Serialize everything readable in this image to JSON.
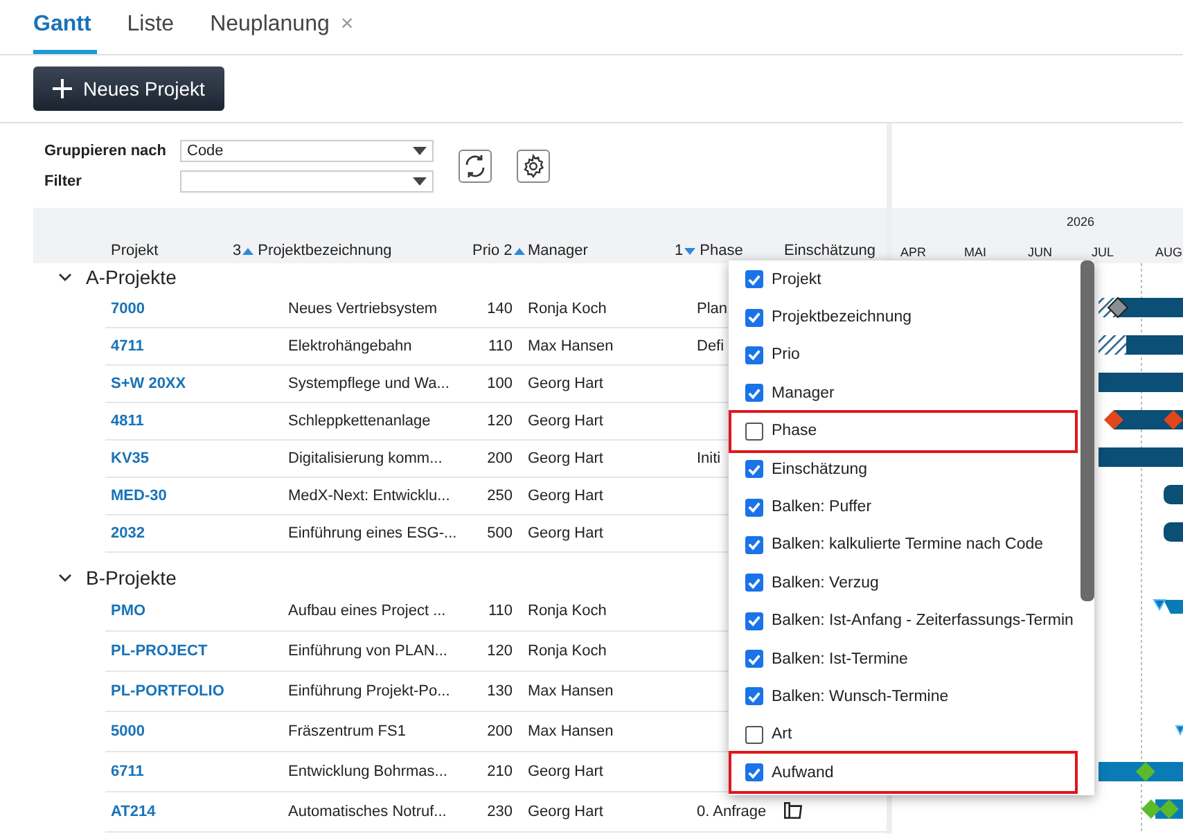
{
  "tabs": [
    {
      "label": "Gantt",
      "selected": true
    },
    {
      "label": "Liste",
      "selected": false
    },
    {
      "label": "Neuplanung",
      "selected": false,
      "close": "×"
    }
  ],
  "new_button": {
    "label": "Neues Projekt"
  },
  "filters": [
    {
      "label": "Gruppieren nach",
      "value": "Code"
    },
    {
      "label": "Filter"
    }
  ],
  "columns": [
    {
      "label": "Projekt",
      "kind": "text"
    },
    {
      "label": "Projektbezeichnung",
      "sort": "3",
      "descending": false,
      "kind": "text"
    },
    {
      "label": "Prio",
      "sort": "2",
      "descending": false,
      "kind": "number"
    },
    {
      "label": "Manager",
      "kind": "text"
    },
    {
      "label": "Phase",
      "sort": "1",
      "descending": true,
      "kind": "text"
    },
    {
      "label": "Einschätzung",
      "kind": "text"
    }
  ],
  "timeline": {
    "year": "2026",
    "months": [
      "APR",
      "MAI",
      "JUN",
      "JUL",
      "AUG"
    ]
  },
  "groups": [
    {
      "label": "A-Projekte",
      "expanded": true,
      "rows": [
        {
          "code": "7000",
          "name": "Neues Vertriebsystem",
          "prio": "140",
          "manager": "Ronja Koch",
          "phase": "Plan",
          "estimate": false
        },
        {
          "code": "4711",
          "name": "Elektrohängebahn",
          "prio": "110",
          "manager": "Max Hansen",
          "phase": "Defi",
          "estimate": false
        },
        {
          "code": "S+W 20XX",
          "name": "Systempflege und Wa...",
          "prio": "100",
          "manager": "Georg Hart",
          "estimate": false
        },
        {
          "code": "4811",
          "name": "Schleppkettenanlage",
          "prio": "120",
          "manager": "Georg Hart",
          "estimate": false
        },
        {
          "code": "KV35",
          "name": "Digitalisierung komm...",
          "prio": "200",
          "manager": "Georg Hart",
          "phase": "Initi",
          "estimate": false
        },
        {
          "code": "MED-30",
          "name": "MedX-Next: Entwicklu...",
          "prio": "250",
          "manager": "Georg Hart",
          "estimate": false
        },
        {
          "code": "2032",
          "name": "Einführung eines ESG-...",
          "prio": "500",
          "manager": "Georg Hart",
          "estimate": false
        }
      ]
    },
    {
      "label": "B-Projekte",
      "expanded": true,
      "rows": [
        {
          "code": "PMO",
          "name": "Aufbau eines Project ...",
          "prio": "110",
          "manager": "Ronja Koch",
          "estimate": false
        },
        {
          "code": "PL-PROJECT",
          "name": "Einführung von PLAN...",
          "prio": "120",
          "manager": "Ronja Koch",
          "estimate": false
        },
        {
          "code": "PL-PORTFOLIO",
          "name": "Einführung Projekt-Po...",
          "prio": "130",
          "manager": "Max Hansen",
          "estimate": false
        },
        {
          "code": "5000",
          "name": "Fräszentrum FS1",
          "prio": "200",
          "manager": "Max Hansen",
          "estimate": false
        },
        {
          "code": "6711",
          "name": "Entwicklung Bohrmas...",
          "prio": "210",
          "manager": "Georg Hart",
          "estimate": false
        },
        {
          "code": "AT214",
          "name": "Automatisches Notruf...",
          "prio": "230",
          "manager": "Georg Hart",
          "phase": "0. Anfrage",
          "estimate": true
        }
      ]
    }
  ],
  "column_menu": [
    {
      "label": "Projekt",
      "checked": true,
      "highlighted": false
    },
    {
      "label": "Projektbezeichnung",
      "checked": true,
      "highlighted": false
    },
    {
      "label": "Prio",
      "checked": true,
      "highlighted": false
    },
    {
      "label": "Manager",
      "checked": true,
      "highlighted": false
    },
    {
      "label": "Phase",
      "checked": false,
      "highlighted": true
    },
    {
      "label": "Einschätzung",
      "checked": true,
      "highlighted": false
    },
    {
      "label": "Balken: Puffer",
      "checked": true,
      "highlighted": false
    },
    {
      "label": "Balken: kalkulierte Termine nach Code",
      "checked": true,
      "highlighted": false
    },
    {
      "label": "Balken: Verzug",
      "checked": true,
      "highlighted": false
    },
    {
      "label": "Balken: Ist-Anfang - Zeiterfassungs-Termin",
      "checked": true,
      "highlighted": false
    },
    {
      "label": "Balken: Ist-Termine",
      "checked": true,
      "highlighted": false
    },
    {
      "label": "Balken: Wunsch-Termine",
      "checked": true,
      "highlighted": false
    },
    {
      "label": "Art",
      "checked": false,
      "highlighted": false
    },
    {
      "label": "Aufwand",
      "checked": true,
      "highlighted": true
    }
  ]
}
